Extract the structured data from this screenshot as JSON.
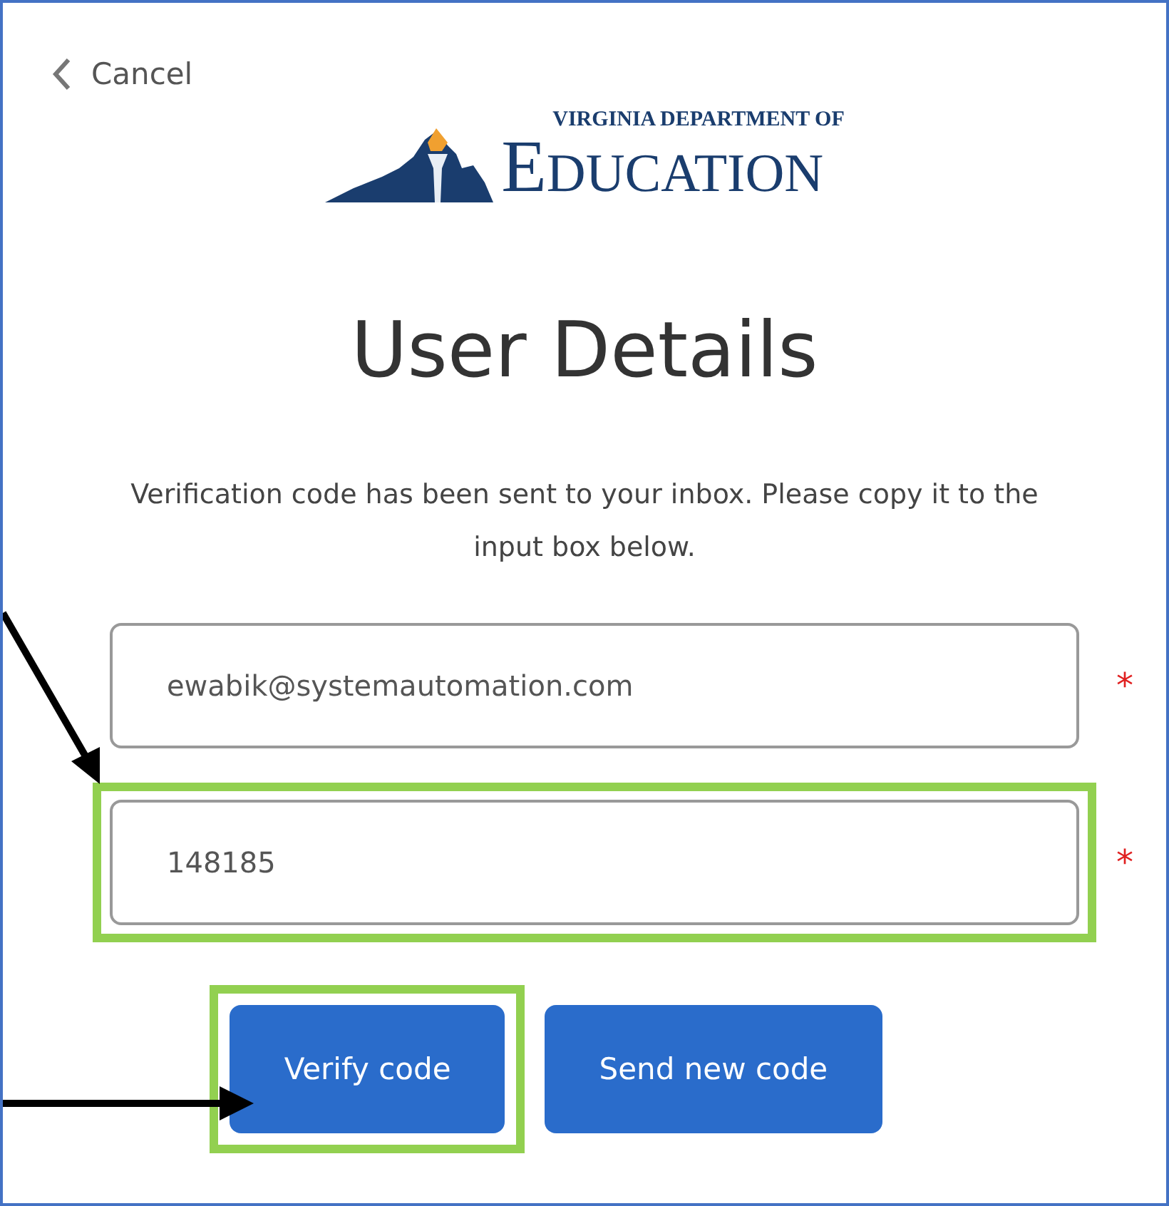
{
  "cancel": {
    "label": "Cancel"
  },
  "logo": {
    "top": "VIRGINIA DEPARTMENT OF",
    "bottom": "EDUCATION"
  },
  "title": "User Details",
  "message": "Verification code has been sent to your inbox. Please copy it to the input box below.",
  "fields": [
    {
      "value": "ewabik@systemautomation.com",
      "required_mark": "*",
      "highlighted": false
    },
    {
      "value": "148185",
      "required_mark": "*",
      "highlighted": true
    }
  ],
  "buttons": [
    {
      "label": "Verify code",
      "highlighted": true
    },
    {
      "label": "Send new code",
      "highlighted": false
    }
  ]
}
